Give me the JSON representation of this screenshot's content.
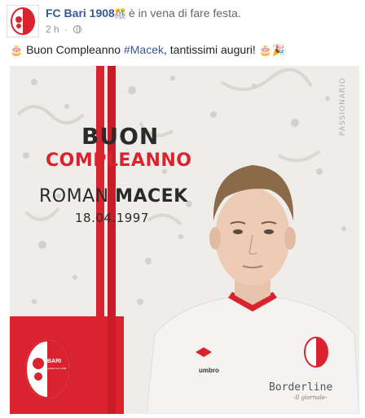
{
  "post": {
    "page_name": "FC Bari 1908",
    "activity_text": "è in vena di fare festa.",
    "activity_emoji": "🎊",
    "timestamp": "2 h",
    "separator": "·",
    "message_prefix": "Buon Compleanno ",
    "hashtag": "#Macek",
    "message_suffix": ", tantissimi auguri! ",
    "emoji_leading": "🎂",
    "emoji_trailing_1": "🎂",
    "emoji_trailing_2": "🎉"
  },
  "image": {
    "headline_line1": "BUON",
    "headline_line2": "COMPLEANNO",
    "first_name": "ROMAN",
    "surname": "MACEK",
    "birthdate": "18.04.1997",
    "watermark": "PASSIONARIO",
    "crest_text": "BARI",
    "crest_subtext": "Football Club 1908",
    "shirt_brand": "umbro",
    "sponsor": "Borderline",
    "sponsor_sub": "-Il giornale-"
  },
  "colors": {
    "link_blue": "#365899",
    "club_red": "#d9232e",
    "background": "#efedea"
  },
  "icons": {
    "privacy": "globe-icon"
  }
}
